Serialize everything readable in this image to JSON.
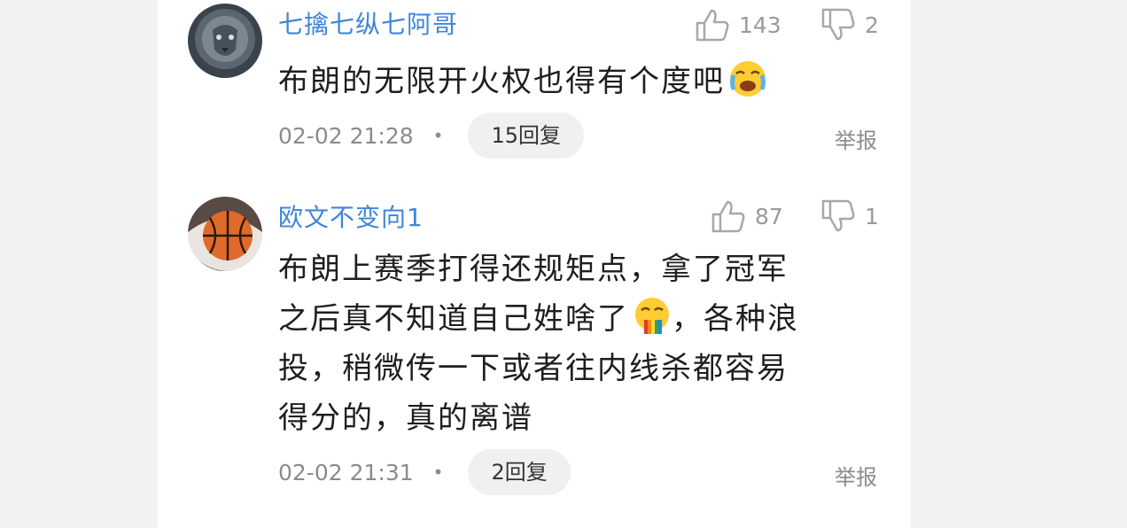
{
  "comments": [
    {
      "username": "七擒七纵七阿哥",
      "likes": "143",
      "dislikes": "2",
      "text_lines": [
        "布朗的无限开火权也得有个度吧"
      ],
      "emoji": "crying-face",
      "time": "02-02 21:28",
      "separator": "•",
      "replies": "15回复",
      "report": "举报"
    },
    {
      "username": "欧文不变向1",
      "likes": "87",
      "dislikes": "1",
      "text_lines": [
        "布朗上赛季打得还规矩点，拿了冠军",
        "之后真不知道自己姓啥了",
        "，各种浪",
        "投，稍微传一下或者往内线杀都容易",
        "得分的，真的离谱"
      ],
      "emoji": "rainbow-vomit-face",
      "time": "02-02 21:31",
      "separator": "•",
      "replies": "2回复",
      "report": "举报"
    }
  ],
  "colors": {
    "username": "#3f86d8",
    "text": "#1e1e1e",
    "meta": "#8b8b8b",
    "reply_bg": "#f0f0f0"
  }
}
